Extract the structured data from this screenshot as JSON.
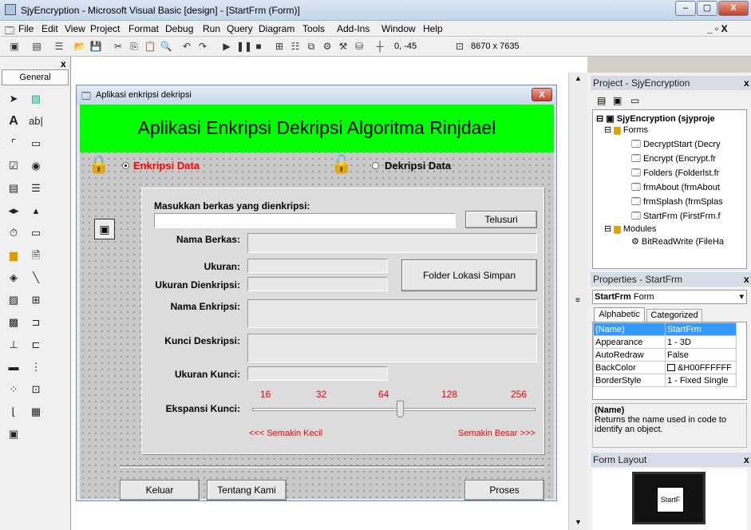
{
  "window": {
    "title": "SjyEncryption - Microsoft Visual Basic [design] - [StartFrm (Form)]",
    "min": "–",
    "max": "▢",
    "close": "X"
  },
  "menu": [
    "File",
    "Edit",
    "View",
    "Project",
    "Format",
    "Debug",
    "Run",
    "Query",
    "Diagram",
    "Tools",
    "Add-Ins",
    "Window",
    "Help"
  ],
  "mdi_controls": "_ ▫ X",
  "toolbar": {
    "coords": "0, -45",
    "size": "8670 x 7635"
  },
  "toolbox": {
    "title": "General",
    "close": "x"
  },
  "form": {
    "caption": "Aplikasi enkripsi dekripsi",
    "close": "X",
    "banner": "Aplikasi Enkripsi Dekripsi Algoritma Rinjdael",
    "option_encrypt": "Enkripsi Data",
    "option_decrypt": "Dekripsi Data",
    "prompt": "Masukkan berkas yang dienkripsi:",
    "browse": "Telusuri",
    "lbl_name": "Nama Berkas:",
    "lbl_size": "Ukuran:",
    "lbl_encsize": "Ukuran Dienkripsi:",
    "folder_btn": "Folder Lokasi Simpan",
    "lbl_encname": "Nama Enkripsi:",
    "lbl_key": "Kunci Deskripsi:",
    "lbl_keysize": "Ukuran Kunci:",
    "lbl_expand": "Ekspansi Kunci:",
    "slider_ticks": [
      "16",
      "32",
      "64",
      "128",
      "256"
    ],
    "slider_value": 64,
    "smaller": "<<< Semakin Kecil",
    "bigger": "Semakin Besar >>>",
    "btn_exit": "Keluar",
    "btn_about": "Tentang Kami",
    "btn_process": "Proses"
  },
  "project": {
    "title": "Project - SjyEncryption",
    "close": "x",
    "root": "SjyEncryption (sjyproje",
    "forms_folder": "Forms",
    "forms": [
      "DecryptStart (Decry",
      "Encrypt (Encrypt.fr",
      "Folders (Folderlst.fr",
      "frmAbout (frmAbout",
      "frmSplash (frmSplas",
      "StartFrm (FirstFrm.f"
    ],
    "modules_folder": "Modules",
    "modules": [
      "BitReadWrite (FileHa"
    ]
  },
  "properties": {
    "title": "Properties - StartFrm",
    "close": "x",
    "object": "StartFrm",
    "object_type": "Form",
    "tab_alpha": "Alphabetic",
    "tab_cat": "Categorized",
    "rows": [
      {
        "name": "(Name)",
        "value": "StartFrm"
      },
      {
        "name": "Appearance",
        "value": "1 - 3D"
      },
      {
        "name": "AutoRedraw",
        "value": "False"
      },
      {
        "name": "BackColor",
        "value": "&H00FFFFFF"
      },
      {
        "name": "BorderStyle",
        "value": "1 - Fixed Single"
      }
    ],
    "desc_title": "(Name)",
    "desc_text": "Returns the name used in code to identify an object."
  },
  "layout": {
    "title": "Form Layout",
    "close": "x",
    "form_label": "StartF"
  },
  "colors": {
    "banner": "#00ff00",
    "accent_red": "#ff0000",
    "selection": "#3399ff"
  }
}
